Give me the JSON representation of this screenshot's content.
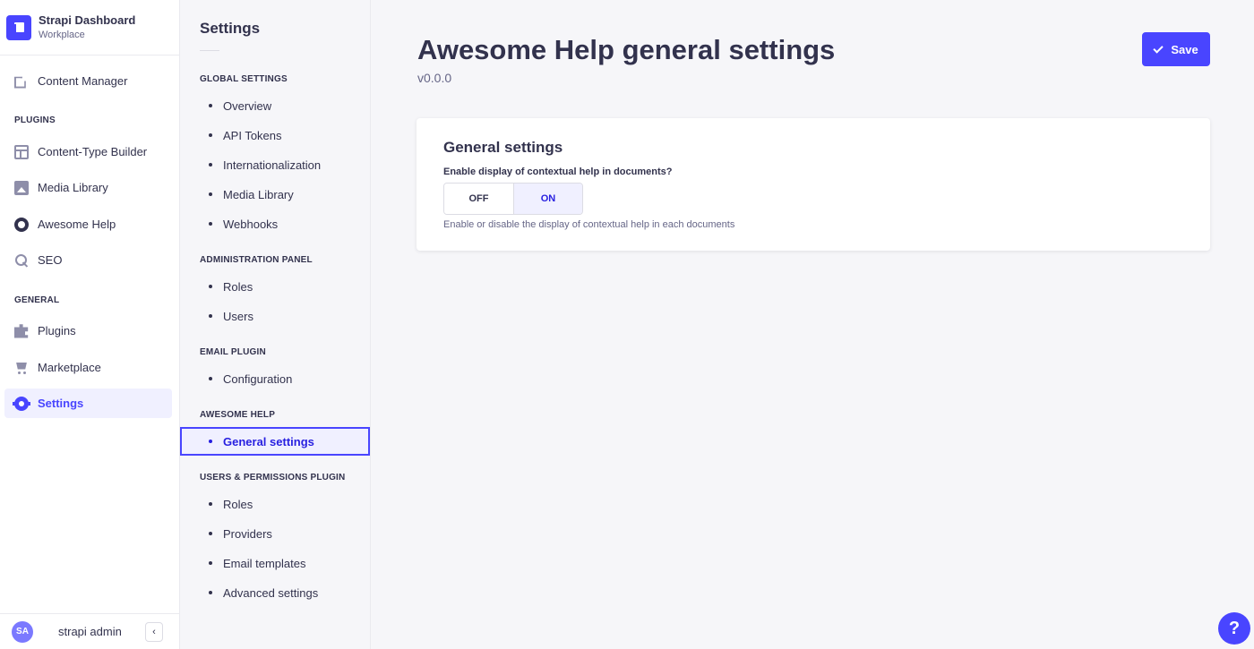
{
  "brand": {
    "title": "Strapi Dashboard",
    "subtitle": "Workplace"
  },
  "mainnav": {
    "content_manager": "Content Manager",
    "plugins_section": "PLUGINS",
    "content_type_builder": "Content-Type Builder",
    "media_library": "Media Library",
    "awesome_help": "Awesome Help",
    "seo": "SEO",
    "general_section": "GENERAL",
    "plugins": "Plugins",
    "marketplace": "Marketplace",
    "settings": "Settings"
  },
  "user": {
    "initials": "SA",
    "name": "strapi admin",
    "collapse_icon": "‹"
  },
  "subnav": {
    "title": "Settings",
    "global_section": "GLOBAL SETTINGS",
    "overview": "Overview",
    "api_tokens": "API Tokens",
    "internationalization": "Internationalization",
    "media_library": "Media Library",
    "webhooks": "Webhooks",
    "admin_section": "ADMINISTRATION PANEL",
    "roles": "Roles",
    "users": "Users",
    "email_section": "EMAIL PLUGIN",
    "configuration": "Configuration",
    "awesome_section": "AWESOME HELP",
    "general_settings": "General settings",
    "up_section": "USERS & PERMISSIONS PLUGIN",
    "up_roles": "Roles",
    "providers": "Providers",
    "email_templates": "Email templates",
    "advanced_settings": "Advanced settings"
  },
  "header": {
    "title": "Awesome Help general settings",
    "version": "v0.0.0",
    "save": "Save"
  },
  "card": {
    "title": "General settings",
    "field_label": "Enable display of contextual help in documents?",
    "off": "OFF",
    "on": "ON",
    "selected": "ON",
    "hint": "Enable or disable the display of contextual help in each documents"
  },
  "help_fab": "?",
  "colors": {
    "primary": "#4945ff",
    "active_bg": "#f0f0ff",
    "text": "#32324d",
    "muted": "#666687"
  }
}
